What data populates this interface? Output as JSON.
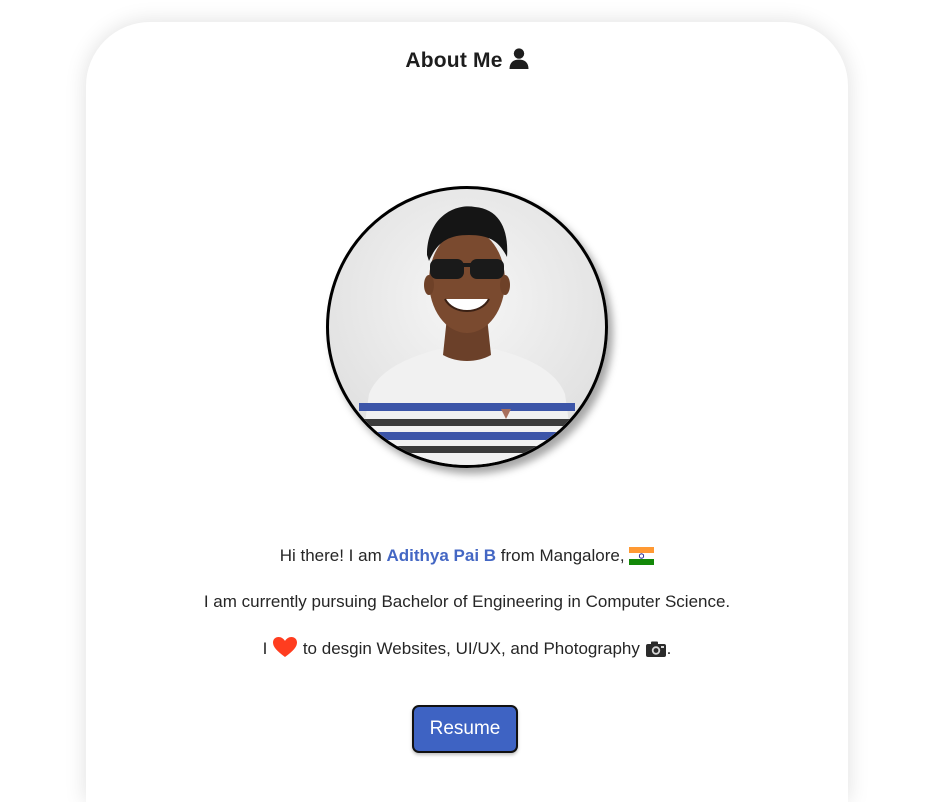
{
  "about": {
    "title": "About Me",
    "title_icon": "user-icon"
  },
  "profile": {
    "photo": "profile-photo",
    "intro_before": "Hi there! I am ",
    "name": "Adithya Pai B",
    "intro_after": " from Mangalore, ",
    "flag_icon": "india-flag-icon",
    "study_line": "I am currently pursuing Bachelor of Engineering in Computer Science.",
    "love_before": "I ",
    "heart_icon": "heart-icon",
    "love_after": " to desgin Websites, UI/UX, and Photography ",
    "camera_icon": "camera-icon",
    "love_end": "."
  },
  "actions": {
    "resume_label": "Resume"
  },
  "colors": {
    "accent": "#4467c4",
    "button_bg": "#3e63c3",
    "heart": "#ff3d1f"
  }
}
